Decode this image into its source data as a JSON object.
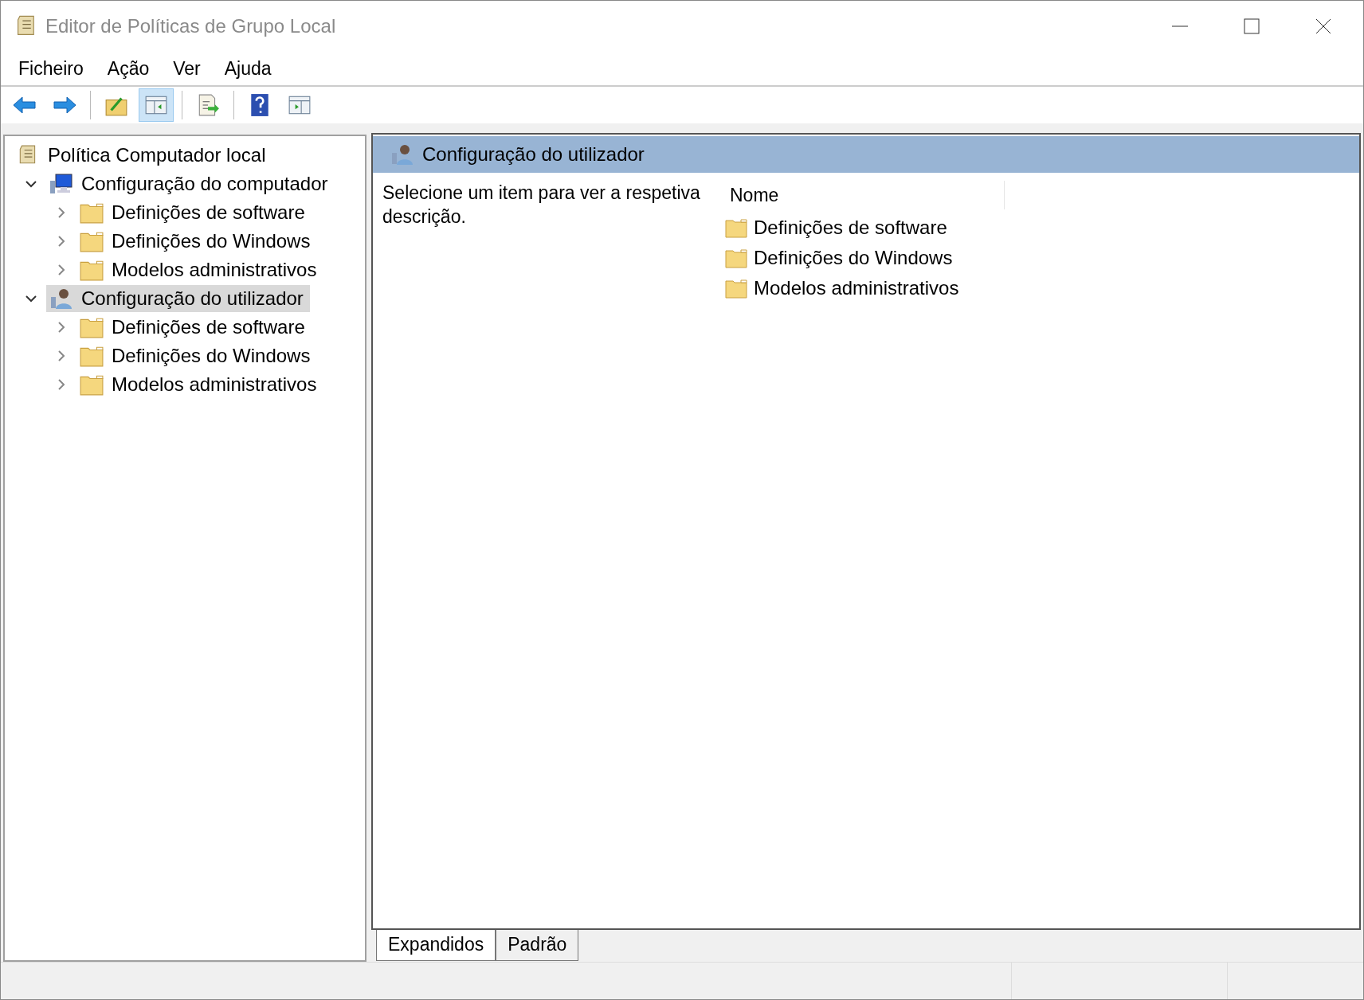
{
  "window": {
    "title": "Editor de Políticas de Grupo Local"
  },
  "menu": [
    "Ficheiro",
    "Ação",
    "Ver",
    "Ajuda"
  ],
  "toolbar": [
    {
      "kind": "back",
      "on": false
    },
    {
      "kind": "forward",
      "on": false
    },
    {
      "kind": "separator"
    },
    {
      "kind": "up",
      "on": false
    },
    {
      "kind": "tree",
      "on": true
    },
    {
      "kind": "separator"
    },
    {
      "kind": "export",
      "on": false
    },
    {
      "kind": "separator"
    },
    {
      "kind": "help",
      "on": false
    },
    {
      "kind": "action",
      "on": false
    }
  ],
  "tree": [
    {
      "label": "Política Computador local",
      "kind": "policy",
      "selected": false,
      "children": [
        {
          "label": "Configuração do computador",
          "kind": "computer",
          "expanded": true,
          "selected": false,
          "children": [
            {
              "label": "Definições de software",
              "kind": "folder",
              "expanded": false,
              "selected": false
            },
            {
              "label": "Definições do Windows",
              "kind": "folder",
              "expanded": false,
              "selected": false
            },
            {
              "label": "Modelos administrativos",
              "kind": "folder",
              "expanded": false,
              "selected": false
            }
          ]
        },
        {
          "label": "Configuração do utilizador",
          "kind": "user",
          "expanded": true,
          "selected": true,
          "children": [
            {
              "label": "Definições de software",
              "kind": "folder",
              "expanded": false,
              "selected": false
            },
            {
              "label": "Definições do Windows",
              "kind": "folder",
              "expanded": false,
              "selected": false
            },
            {
              "label": "Modelos administrativos",
              "kind": "folder",
              "expanded": false,
              "selected": false
            }
          ]
        }
      ]
    }
  ],
  "details": {
    "header": "Configuração do utilizador",
    "description": "Selecione um item para ver a respetiva descrição.",
    "column": "Nome",
    "items": [
      "Definições de software",
      "Definições do Windows",
      "Modelos administrativos"
    ]
  },
  "tabs": [
    {
      "label": "Expandidos",
      "selected": true
    },
    {
      "label": "Padrão",
      "selected": false
    }
  ]
}
